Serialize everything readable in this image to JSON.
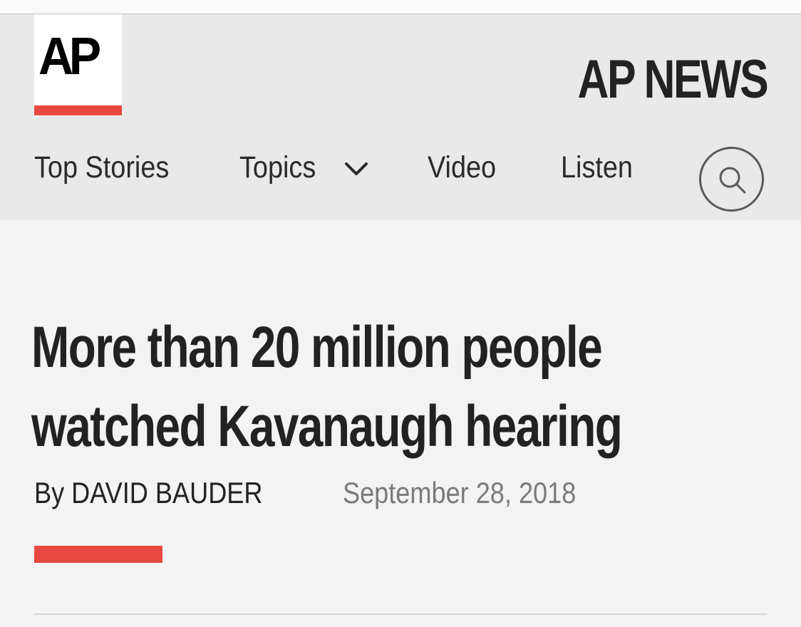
{
  "brand": {
    "logo_text": "AP",
    "site_name": "AP NEWS",
    "accent_color": "#e8483f"
  },
  "nav": {
    "items": [
      {
        "label": "Top Stories"
      },
      {
        "label": "Topics"
      },
      {
        "label": "Video"
      },
      {
        "label": "Listen"
      }
    ],
    "topics_icon": "chevron-down-icon",
    "search_icon": "search-icon"
  },
  "article": {
    "headline": "More than 20 million people watched Kavanaugh hearing",
    "byline": "By DAVID BAUDER",
    "date": "September 28, 2018"
  }
}
